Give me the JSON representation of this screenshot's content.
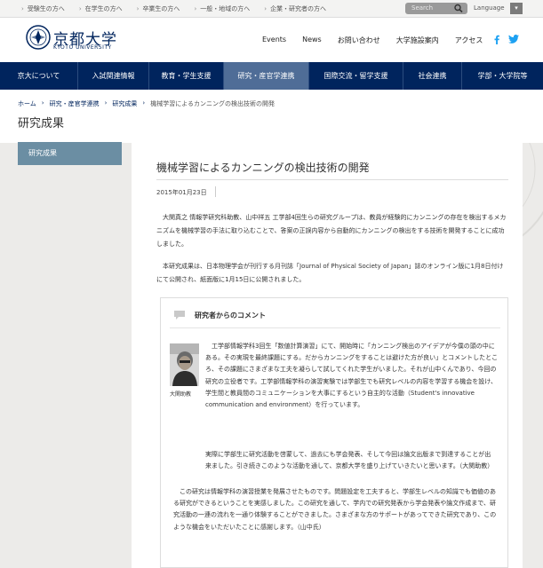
{
  "toplinks": [
    "受験生の方へ",
    "在学生の方へ",
    "卒業生の方へ",
    "一般・地域の方へ",
    "企業・研究者の方へ"
  ],
  "search": {
    "placeholder": "Search"
  },
  "language": {
    "label": "Language"
  },
  "logo": {
    "jp": "京都大学",
    "en": "KYOTO UNIVERSITY"
  },
  "headnav": [
    "Events",
    "News",
    "お問い合わせ",
    "大学施設案内",
    "アクセス"
  ],
  "mainnav": [
    {
      "label": "京大について",
      "active": false
    },
    {
      "label": "入試関連情報",
      "active": false
    },
    {
      "label": "教育・学生支援",
      "active": false
    },
    {
      "label": "研究・産官学連携",
      "active": true
    },
    {
      "label": "国際交流・留学支援",
      "active": false
    },
    {
      "label": "社会連携",
      "active": false
    },
    {
      "label": "学部・大学院等",
      "active": false
    }
  ],
  "breadcrumb": [
    "ホーム",
    "研究・産官学連携",
    "研究成果",
    "機械学習によるカンニングの検出技術の開発"
  ],
  "page_title": "研究成果",
  "sidebar": {
    "active_item": "研究成果"
  },
  "article": {
    "title": "機械学習によるカンニングの検出技術の開発",
    "date": "2015年01月23日",
    "paragraphs": [
      "大関真之 情報学研究科助教、山中祥五 工学部4回生らの研究グループは、教員が経験的にカンニングの存在を検出するメカニズムを機械学習の手法に取り込むことで、答案の正誤内容から自動的にカンニングの検出をする技術を開発することに成功しました。",
      "本研究成果は、日本物理学会が刊行する月刊誌「Journal of Physical Society of Japan」誌のオンライン版に1月8日付けにて公開され、紙面版に1月15日に公開されました。"
    ]
  },
  "comment": {
    "heading": "研究者からのコメント",
    "photo_caption": "大関助教",
    "text1": "工学部情報学科3回生「数値計算演習」にて、開始時に「カンニング検出のアイデアが今僕の頭の中にある。その実現を最終課題にする。だからカンニングをすることは避けた方が良い」とコメントしたところ、その課題にさまざまな工夫を凝らして試してくれた学生がいました。それが山中くんであり、今回の研究の立役者です。工学部情報学科の演習実験では学部生でも研究レベルの内容を学習する機会を設け、学生間と教員間のコミュニケーションを大事にするという自主的な活動（Student's innovative communication and environment）を行っています。",
    "text1b": "実際に学部生に研究活動を啓蒙して、過去にも学会発表、そして今回は論文出版まで到達することが出来ました。引き続きこのような活動を通して、京都大学を盛り上げていきたいと思います。（大関助教）",
    "text2": "この研究は情報学科の演習授業を発展させたものです。問題設定を工夫すると、学部生レベルの知識でも価値のある研究ができるということを実感しました。この研究を通して、学内での研究発表から学会発表や論文作成まで、研究活動の一連の流れを一通り体験することができました。さまざまな方のサポートがあってできた研究であり、このような機会をいただいたことに感謝します。（山中氏）"
  },
  "colors": {
    "navy": "#00245d",
    "nav_active": "#4f6d97",
    "sidebar": "#6b8ea3",
    "twitter": "#1da1f2"
  }
}
